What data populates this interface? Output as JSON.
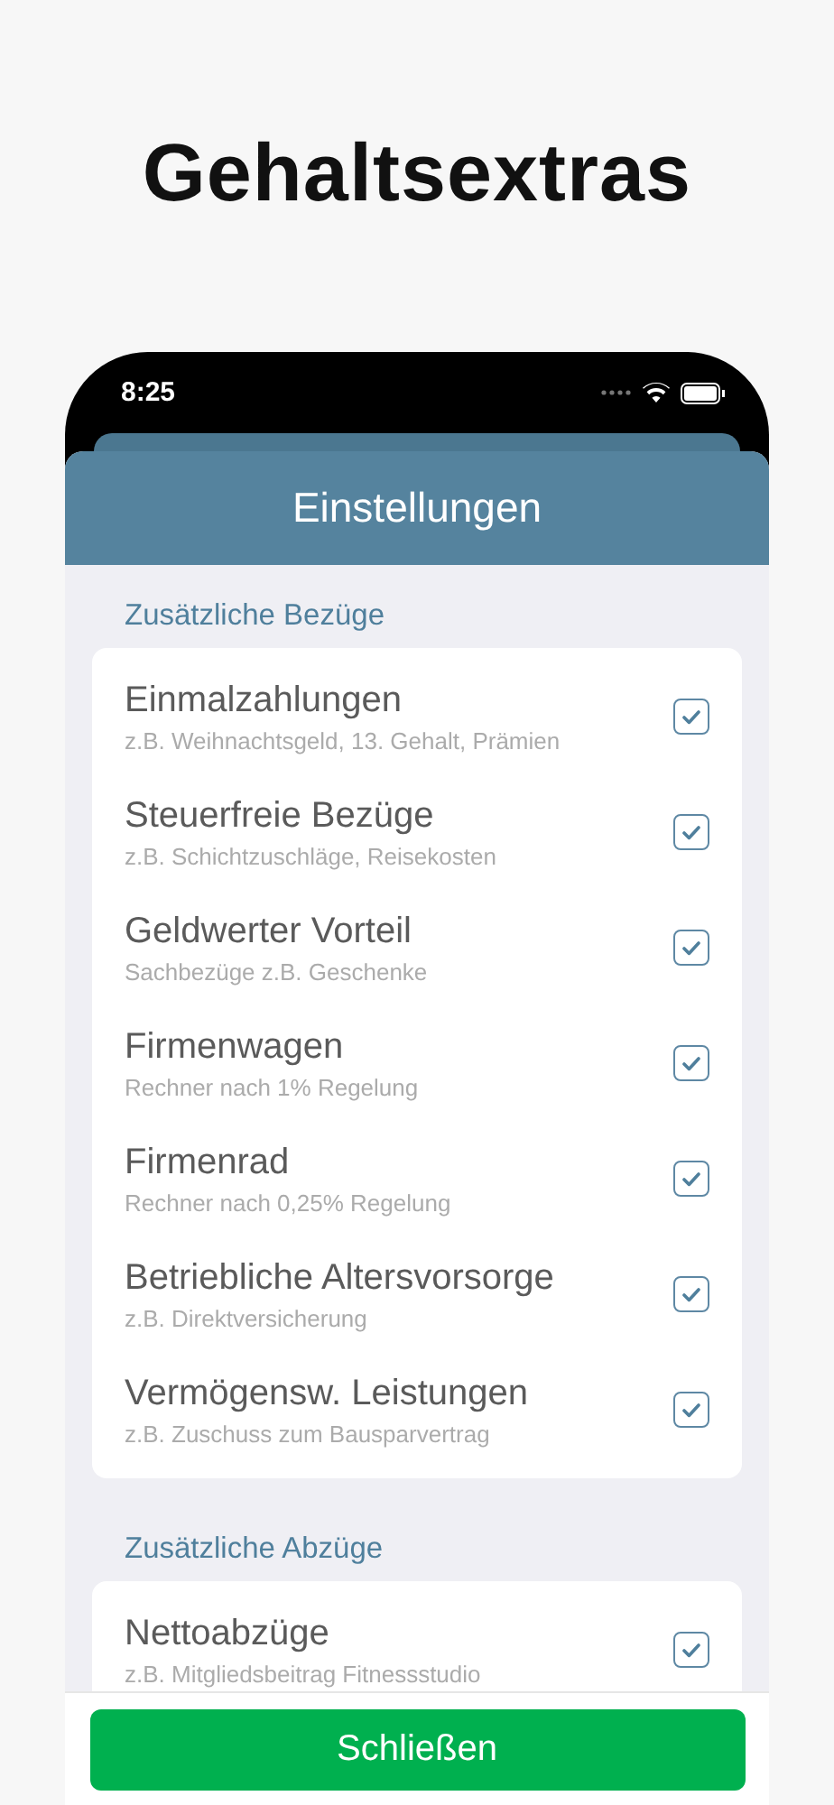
{
  "headline": "Gehaltsextras",
  "status_bar": {
    "time": "8:25"
  },
  "sheet": {
    "title": "Einstellungen"
  },
  "sections": [
    {
      "title": "Zusätzliche Bezüge",
      "items": [
        {
          "title": "Einmalzahlungen",
          "subtitle": "z.B. Weihnachtsgeld, 13. Gehalt, Prämien",
          "checked": true
        },
        {
          "title": "Steuerfreie Bezüge",
          "subtitle": "z.B. Schichtzuschläge, Reisekosten",
          "checked": true
        },
        {
          "title": "Geldwerter Vorteil",
          "subtitle": "Sachbezüge z.B. Geschenke",
          "checked": true
        },
        {
          "title": "Firmenwagen",
          "subtitle": "Rechner nach 1% Regelung",
          "checked": true
        },
        {
          "title": "Firmenrad",
          "subtitle": "Rechner nach 0,25% Regelung",
          "checked": true
        },
        {
          "title": "Betriebliche Altersvorsorge",
          "subtitle": "z.B. Direktversicherung",
          "checked": true
        },
        {
          "title": "Vermögensw. Leistungen",
          "subtitle": "z.B. Zuschuss zum Bausparvertrag",
          "checked": true
        }
      ]
    },
    {
      "title": "Zusätzliche Abzüge",
      "items": [
        {
          "title": "Nettoabzüge",
          "subtitle": "z.B. Mitgliedsbeitrag Fitnessstudio",
          "checked": true
        }
      ]
    }
  ],
  "close_button": "Schließen"
}
